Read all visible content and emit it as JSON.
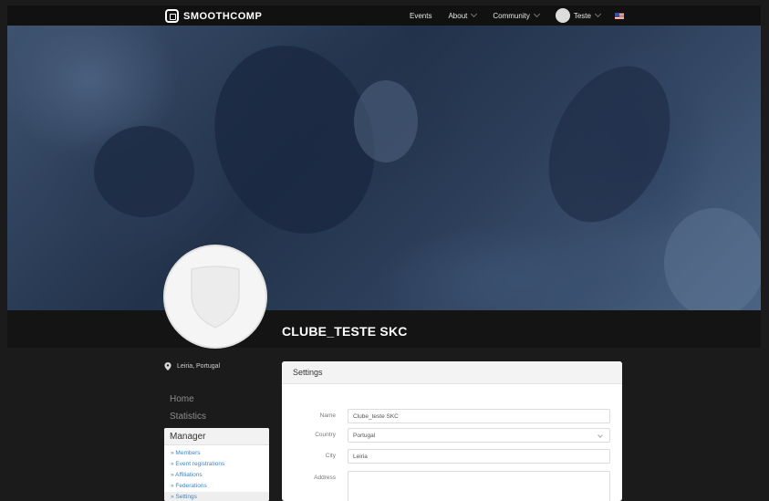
{
  "nav": {
    "brand": "SMOOTHCOMP",
    "events": "Events",
    "about": "About",
    "community": "Community",
    "user": "Teste"
  },
  "club": {
    "name": "CLUBE_TESTE SKC",
    "location": "Leiria, Portugal"
  },
  "sidebar": {
    "home": "Home",
    "statistics": "Statistics",
    "manager": {
      "title": "Manager",
      "links": [
        "» Members",
        "» Event registrations",
        "» Affiliations",
        "» Federations",
        "» Settings"
      ]
    }
  },
  "settings": {
    "title": "Settings",
    "fields": {
      "name": {
        "label": "Name",
        "value": "Clube_teste SKC"
      },
      "country": {
        "label": "Country",
        "value": "Portugal"
      },
      "city": {
        "label": "City",
        "value": "Leiria"
      },
      "address": {
        "label": "Address",
        "value": ""
      }
    }
  },
  "colors": {
    "link": "#3a86c8",
    "page_bg": "#1b1b1b",
    "hero_tint": "#2b3d58"
  }
}
